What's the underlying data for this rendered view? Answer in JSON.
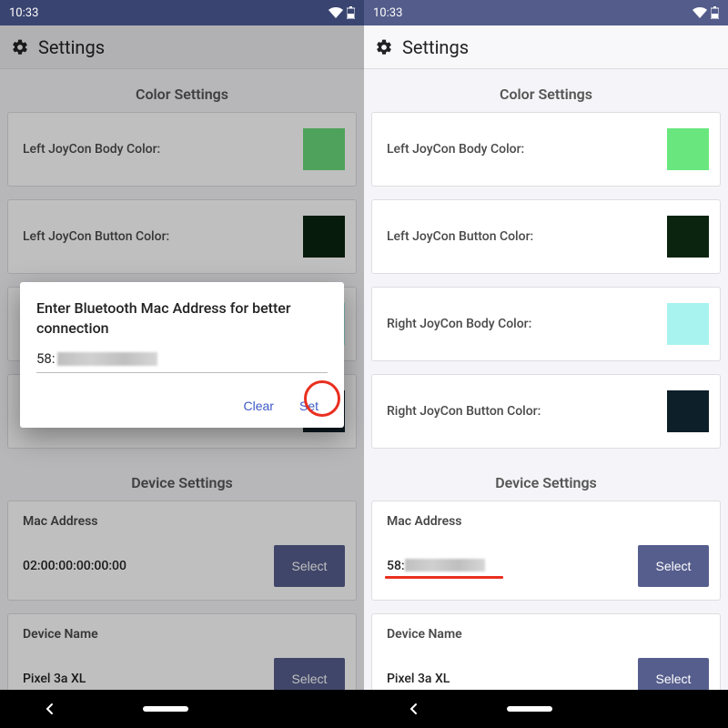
{
  "status": {
    "time": "10:33"
  },
  "app_bar": {
    "title": "Settings"
  },
  "sections": {
    "color_heading": "Color Settings",
    "device_heading": "Device Settings"
  },
  "color_rows": {
    "left_body": {
      "label": "Left JoyCon Body Color:",
      "color": "#69d97a"
    },
    "left_button": {
      "label": "Left JoyCon Button Color:",
      "color": "#0a2410"
    },
    "right_body": {
      "label": "Right JoyCon Body Color:",
      "color": "#a8f3ef"
    },
    "right_button": {
      "label": "Right JoyCon Button Color:",
      "color": "#0d2029"
    }
  },
  "device": {
    "mac_label": "Mac Address",
    "mac_value_left": "02:00:00:00:00:00",
    "mac_prefix_right": "58:",
    "name_label": "Device Name",
    "name_value": "Pixel 3a XL",
    "select_label": "Select"
  },
  "dialog": {
    "title": "Enter Bluetooth Mac Address for better connection",
    "input_prefix": "58:",
    "clear_label": "Clear",
    "set_label": "Set"
  }
}
